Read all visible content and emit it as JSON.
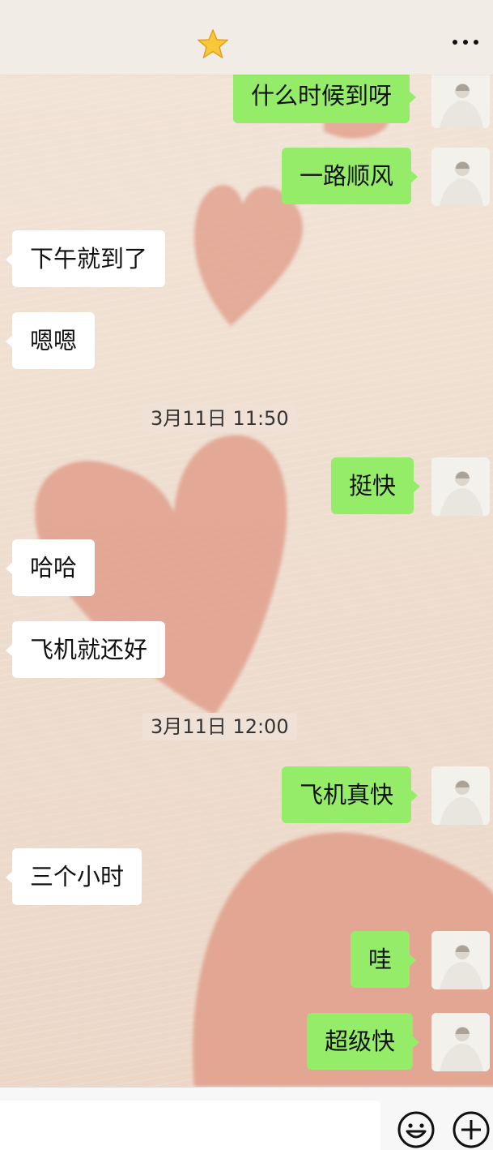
{
  "header": {
    "title_icon": "star-icon",
    "menu_icon": "more-icon"
  },
  "messages": [
    {
      "side": "me",
      "text": "什么时候到呀"
    },
    {
      "side": "me",
      "text": "一路顺风"
    },
    {
      "side": "them",
      "text": "下午就到了"
    },
    {
      "side": "them",
      "text": "嗯嗯"
    },
    {
      "type": "time",
      "text": "3月11日 11:50"
    },
    {
      "side": "me",
      "text": "挺快"
    },
    {
      "side": "them",
      "text": "哈哈"
    },
    {
      "side": "them",
      "text": "飞机就还好"
    },
    {
      "type": "time",
      "text": "3月11日 12:00"
    },
    {
      "side": "me",
      "text": "飞机真快"
    },
    {
      "side": "them",
      "text": "三个小时"
    },
    {
      "side": "me",
      "text": "哇"
    },
    {
      "side": "me",
      "text": "超级快"
    }
  ],
  "footer": {
    "input_value": "",
    "emoji_icon": "emoji-icon",
    "add_icon": "plus-icon"
  },
  "colors": {
    "my_bubble": "#95ec69",
    "their_bubble": "#ffffff",
    "heart": "#e4a08c"
  }
}
